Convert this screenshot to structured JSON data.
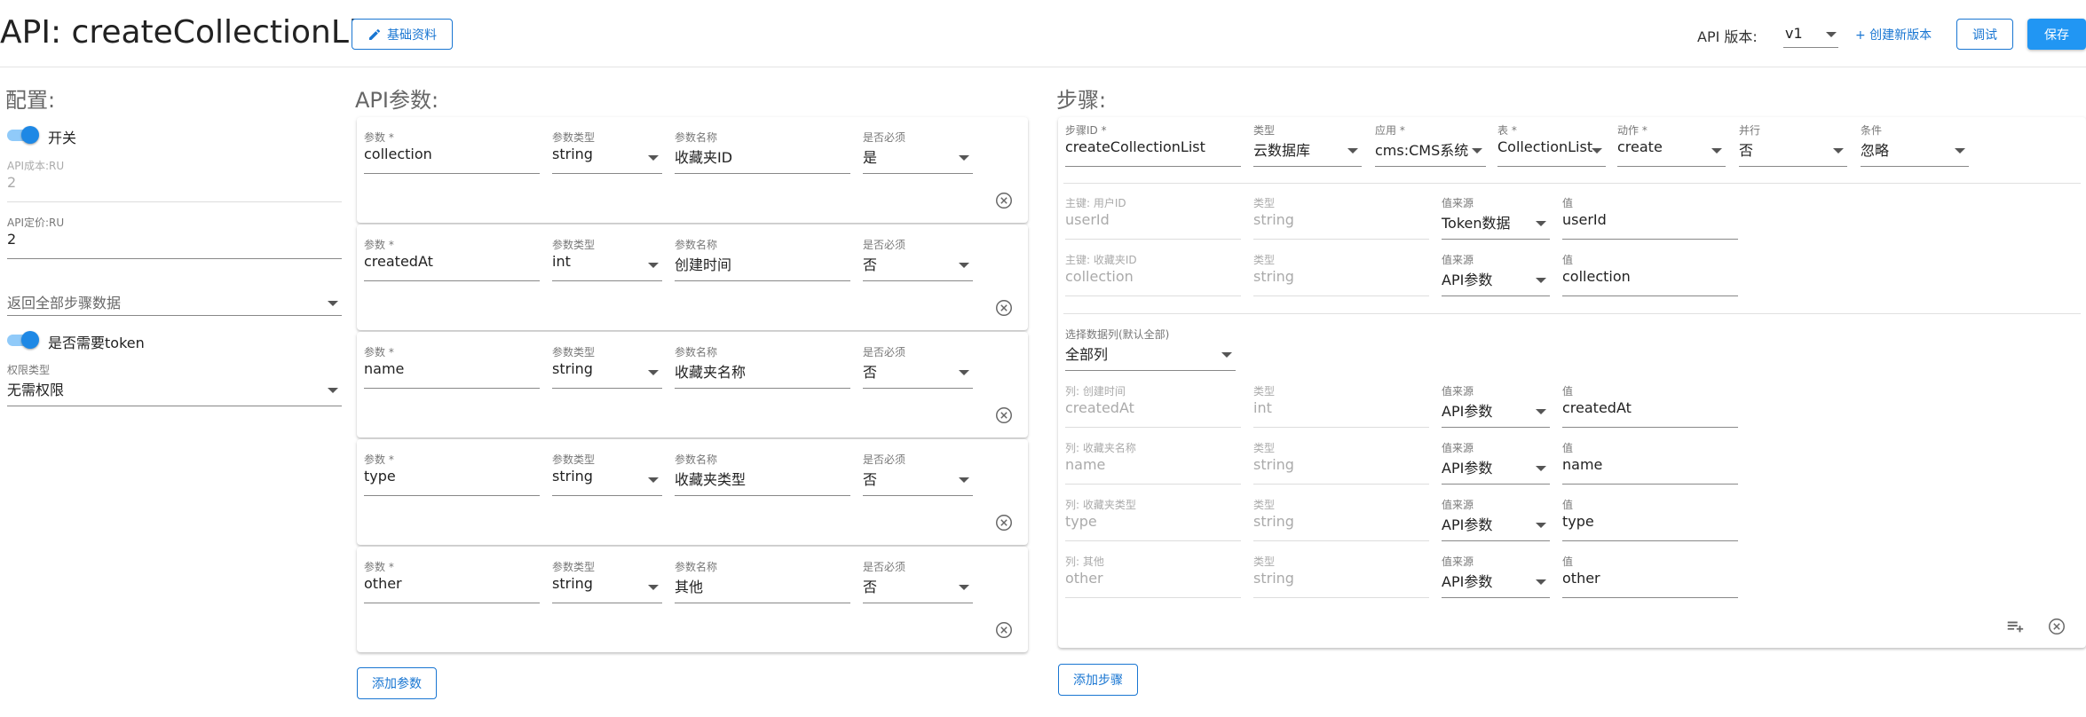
{
  "header": {
    "title": "API: createCollectionList",
    "basic_info_label": "基础资料",
    "version_label": "API 版本:",
    "version_value": "v1",
    "create_version_label": "+ 创建新版本",
    "debug_label": "调试",
    "save_label": "保存"
  },
  "config": {
    "title": "配置:",
    "switch_label": "开关",
    "cost": {
      "label": "API成本:RU",
      "value": "2"
    },
    "price": {
      "label": "API定价:RU",
      "value": "2"
    },
    "return_select": "返回全部步骤数据",
    "token_label": "是否需要token",
    "permission": {
      "label": "权限类型",
      "value": "无需权限"
    }
  },
  "params": {
    "title": "API参数:",
    "labels": {
      "name": "参数 *",
      "type": "参数类型",
      "display": "参数名称",
      "required": "是否必须"
    },
    "items": [
      {
        "name": "collection",
        "type": "string",
        "display": "收藏夹ID",
        "required": "是"
      },
      {
        "name": "createdAt",
        "type": "int",
        "display": "创建时间",
        "required": "否"
      },
      {
        "name": "name",
        "type": "string",
        "display": "收藏夹名称",
        "required": "否"
      },
      {
        "name": "type",
        "type": "string",
        "display": "收藏夹类型",
        "required": "否"
      },
      {
        "name": "other",
        "type": "string",
        "display": "其他",
        "required": "否"
      }
    ],
    "add_label": "添加参数"
  },
  "steps": {
    "title": "步骤:",
    "header_labels": {
      "id": "步骤ID *",
      "type": "类型",
      "app": "应用 *",
      "table": "表 *",
      "action": "动作 *",
      "parallel": "并行",
      "condition": "条件"
    },
    "header_values": {
      "id": "createCollectionList",
      "type": "云数据库",
      "app": "cms:CMS系统",
      "table": "CollectionList",
      "action": "create",
      "parallel": "否",
      "condition": "忽略"
    },
    "col_labels": {
      "type": "类型",
      "source": "值来源",
      "value": "值"
    },
    "keys": [
      {
        "label": "主键: 用户ID",
        "field": "userId",
        "type": "string",
        "source": "Token数据",
        "value": "userId"
      },
      {
        "label": "主键: 收藏夹ID",
        "field": "collection",
        "type": "string",
        "source": "API参数",
        "value": "collection"
      }
    ],
    "select_cols": {
      "label": "选择数据列(默认全部)",
      "value": "全部列"
    },
    "columns": [
      {
        "label": "列: 创建时间",
        "field": "createdAt",
        "type": "int",
        "source": "API参数",
        "value": "createdAt"
      },
      {
        "label": "列: 收藏夹名称",
        "field": "name",
        "type": "string",
        "source": "API参数",
        "value": "name"
      },
      {
        "label": "列: 收藏夹类型",
        "field": "type",
        "type": "string",
        "source": "API参数",
        "value": "type"
      },
      {
        "label": "列: 其他",
        "field": "other",
        "type": "string",
        "source": "API参数",
        "value": "other"
      }
    ],
    "add_label": "添加步骤"
  },
  "colors": {
    "primary": "#1976d2",
    "primary_button": "#2196f3",
    "toggle_track": "#90caf9",
    "toggle_knob": "#1e88e5"
  },
  "icons": [
    "pencil-icon",
    "chevron-down-icon",
    "close-circle-icon",
    "playlist-add-icon"
  ]
}
